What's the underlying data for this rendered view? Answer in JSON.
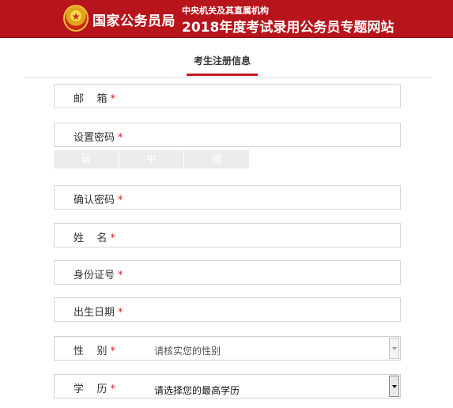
{
  "header": {
    "brand": "国家公务员局",
    "subtitle": "中央机关及其直属机构",
    "title": "2018年度考试录用公务员专题网站"
  },
  "tab": {
    "label": "考生注册信息"
  },
  "fields": {
    "email": {
      "label": "邮    箱",
      "required_mark": "*"
    },
    "password": {
      "label": "设置密码",
      "required_mark": "*"
    },
    "confirm_password": {
      "label": "确认密码",
      "required_mark": "*"
    },
    "name": {
      "label": "姓    名",
      "required_mark": "*"
    },
    "id_number": {
      "label": "身份证号",
      "required_mark": "*"
    },
    "birthdate": {
      "label": "出生日期",
      "required_mark": "*"
    },
    "gender": {
      "label": "性    别",
      "required_mark": "*",
      "selected": "请核实您的性别"
    },
    "education": {
      "label": "学    历",
      "required_mark": "*",
      "selected": "请选择您的最高学历"
    }
  },
  "password_strength": {
    "weak": "弱",
    "medium": "中",
    "strong": "强"
  },
  "colors": {
    "header_red": "#b8141b",
    "required_red": "#d9232a",
    "tab_underline": "#c8161d"
  }
}
